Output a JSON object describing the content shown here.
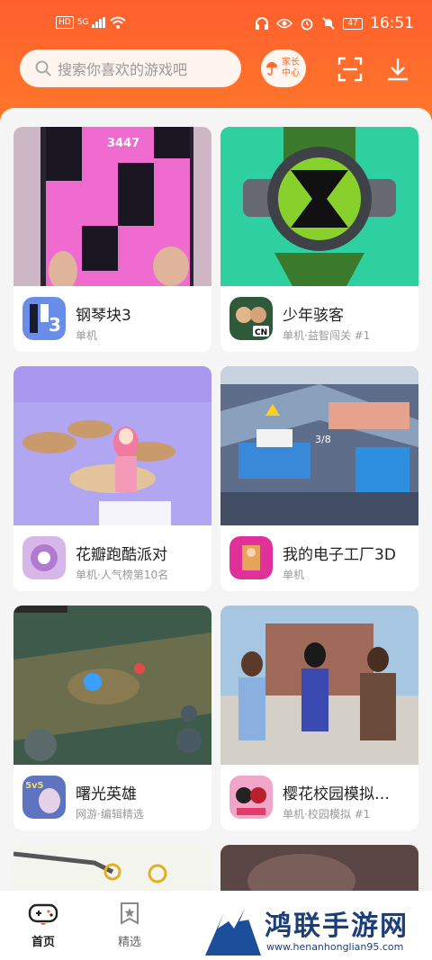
{
  "statusbar": {
    "hd": "HD",
    "signal": "5G",
    "battery": "47",
    "time": "16:51"
  },
  "header": {
    "search_placeholder": "搜索你喜欢的游戏吧",
    "parent_center_label": "家长中心",
    "accent": "#ff6a2c"
  },
  "games": [
    {
      "name": "钢琴块3",
      "sub": "单机"
    },
    {
      "name": "少年骇客",
      "sub": "单机·益智闯关 #1"
    },
    {
      "name": "花瓣跑酷派对",
      "sub": "单机·人气榜第10名"
    },
    {
      "name": "我的电子工厂3D",
      "sub": "单机"
    },
    {
      "name": "曙光英雄",
      "sub": "网游·编辑精选"
    },
    {
      "name": "樱花校园模拟…",
      "sub": "单机·校园模拟 #1"
    }
  ],
  "thumb_texts": {
    "score": "3447",
    "counter": "3/8",
    "icon_num": "3",
    "icon_5v5": "5v5",
    "icon_cn": "CN"
  },
  "bottom_nav": {
    "home": "首页",
    "featured": "精选"
  },
  "watermark": {
    "title": "鸿联手游网",
    "url": "www.henanhonglian95.com"
  }
}
